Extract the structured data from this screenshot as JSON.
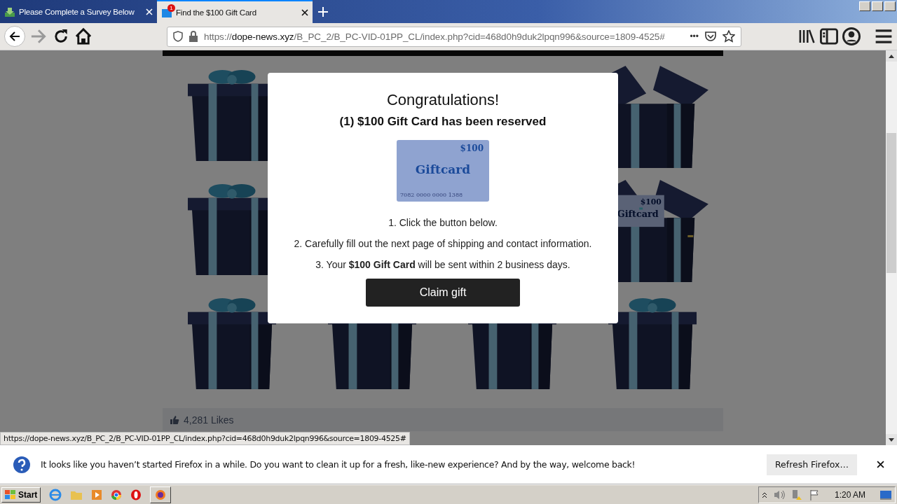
{
  "tabs": [
    {
      "title": "Please Complete a Survey Below",
      "selected": false
    },
    {
      "title": "Find the $100 Gift Card",
      "selected": true,
      "badge": "1"
    }
  ],
  "address_bar": {
    "scheme": "https://",
    "host": "dope-news.xyz",
    "path": "/B_PC_2/B_PC-VID-01PP_CL/index.php?cid=468d0h9duk2lpqn996&source=1809-4525#",
    "more": "•••"
  },
  "gifts": [
    {
      "kind": "closed"
    },
    {
      "kind": "hidden"
    },
    {
      "kind": "hidden"
    },
    {
      "kind": "open"
    },
    {
      "kind": "closed"
    },
    {
      "kind": "hidden"
    },
    {
      "kind": "hidden"
    },
    {
      "kind": "open_card",
      "card_amount": "$100",
      "card_label": "Giftcard"
    },
    {
      "kind": "closed"
    },
    {
      "kind": "closed"
    },
    {
      "kind": "closed"
    },
    {
      "kind": "closed"
    }
  ],
  "likes": "4,281 Likes",
  "modal": {
    "title": "Congratulations!",
    "subtitle": "(1) $100 Gift Card has been reserved",
    "card": {
      "amount": "$100",
      "label": "Giftcard",
      "number": "7082 0000 0000 1388"
    },
    "steps": [
      "1. Click the button below.",
      "2. Carefully fill out the next page of shipping and contact information.",
      "3. Your **$100 Gift Card** will be sent within 2 business days."
    ],
    "button": "Claim gift"
  },
  "status_url": "https://dope-news.xyz/B_PC_2/B_PC-VID-01PP_CL/index.php?cid=468d0h9duk2lpqn996&source=1809-4525#",
  "notification": {
    "message": "It looks like you haven’t started Firefox in a while. Do you want to clean it up for a fresh, like-new experience? And by the way, welcome back!",
    "button": "Refresh Firefox…"
  },
  "taskbar": {
    "start": "Start",
    "time": "1:20 AM"
  }
}
